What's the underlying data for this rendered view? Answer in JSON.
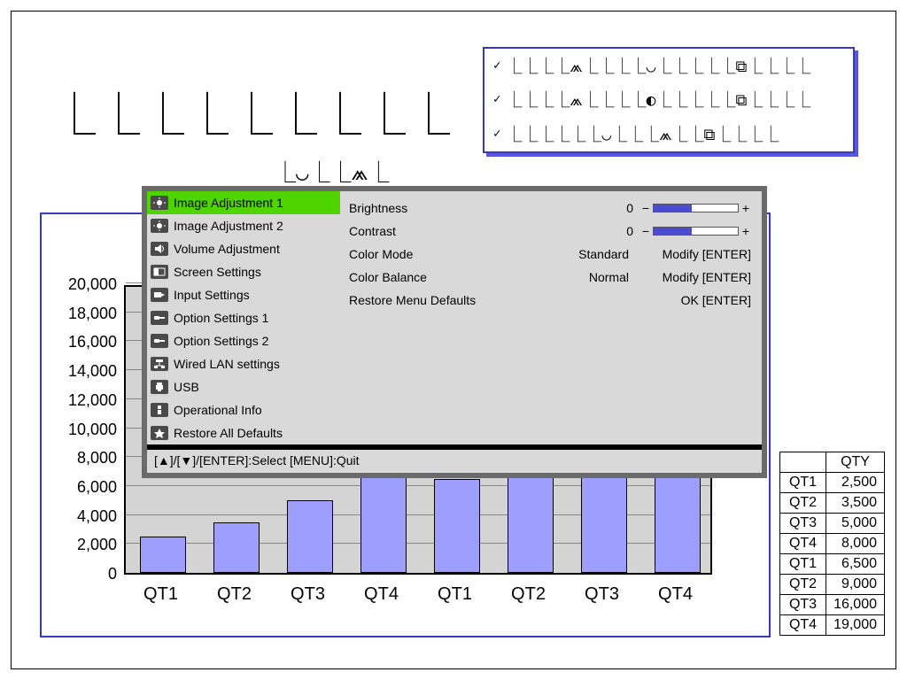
{
  "placeholder_top": "⎿⎿⎿⎿⎿⎿⎿⎿⎿",
  "placeholder_small": "⎿◡⎿⎿⩕⎿",
  "legend": [
    "⎿⎿⎿⎿⩕⎿⎿⎿⎿◡⎿⎿⎿⎿⎿⧉⎿⎿⎿⎿",
    "⎿⎿⎿⎿⩕⎿⎿⎿⎿◐⎿⎿⎿⎿⎿⧉⎿⎿⎿⎿",
    "⎿⎿⎿⎿⎿⎿◡⎿⎿⎿⩕⎿⎿⧉⎿⎿⎿⎿"
  ],
  "chart_data": {
    "type": "bar",
    "categories": [
      "QT1",
      "QT2",
      "QT3",
      "QT4",
      "QT1",
      "QT2",
      "QT3",
      "QT4"
    ],
    "values": [
      2500,
      3500,
      5000,
      8000,
      6500,
      9000,
      16000,
      19000
    ],
    "ylim": [
      0,
      20000
    ],
    "yticks": [
      0,
      2000,
      4000,
      6000,
      8000,
      10000,
      12000,
      14000,
      16000,
      18000,
      20000
    ],
    "ytick_labels": [
      "0",
      "2,000",
      "4,000",
      "6,000",
      "8,000",
      "10,000",
      "12,000",
      "14,000",
      "16,000",
      "18,000",
      "20,000"
    ]
  },
  "table": {
    "header": "QTY",
    "rows": [
      {
        "cat": "QT1",
        "val": "2,500"
      },
      {
        "cat": "QT2",
        "val": "3,500"
      },
      {
        "cat": "QT3",
        "val": "5,000"
      },
      {
        "cat": "QT4",
        "val": "8,000"
      },
      {
        "cat": "QT1",
        "val": "6,500"
      },
      {
        "cat": "QT2",
        "val": "9,000"
      },
      {
        "cat": "QT3",
        "val": "16,000"
      },
      {
        "cat": "QT4",
        "val": "19,000"
      }
    ]
  },
  "osd": {
    "menu": [
      "Image Adjustment 1",
      "Image Adjustment 2",
      "Volume Adjustment",
      "Screen Settings",
      "Input Settings",
      "Option Settings 1",
      "Option Settings 2",
      "Wired LAN settings",
      "USB",
      "Operational Info",
      "Restore All Defaults"
    ],
    "selected_index": 0,
    "options": {
      "brightness": {
        "label": "Brightness",
        "value": "0",
        "fill": 0.45
      },
      "contrast": {
        "label": "Contrast",
        "value": "0",
        "fill": 0.45
      },
      "color_mode": {
        "label": "Color Mode",
        "value": "Standard",
        "action": "Modify [ENTER]"
      },
      "color_balance": {
        "label": "Color Balance",
        "value": "Normal",
        "action": "Modify [ENTER]"
      },
      "restore": {
        "label": "Restore Menu Defaults",
        "action": "OK [ENTER]"
      }
    },
    "footer": "[▲]/[▼]/[ENTER]:Select  [MENU]:Quit"
  }
}
